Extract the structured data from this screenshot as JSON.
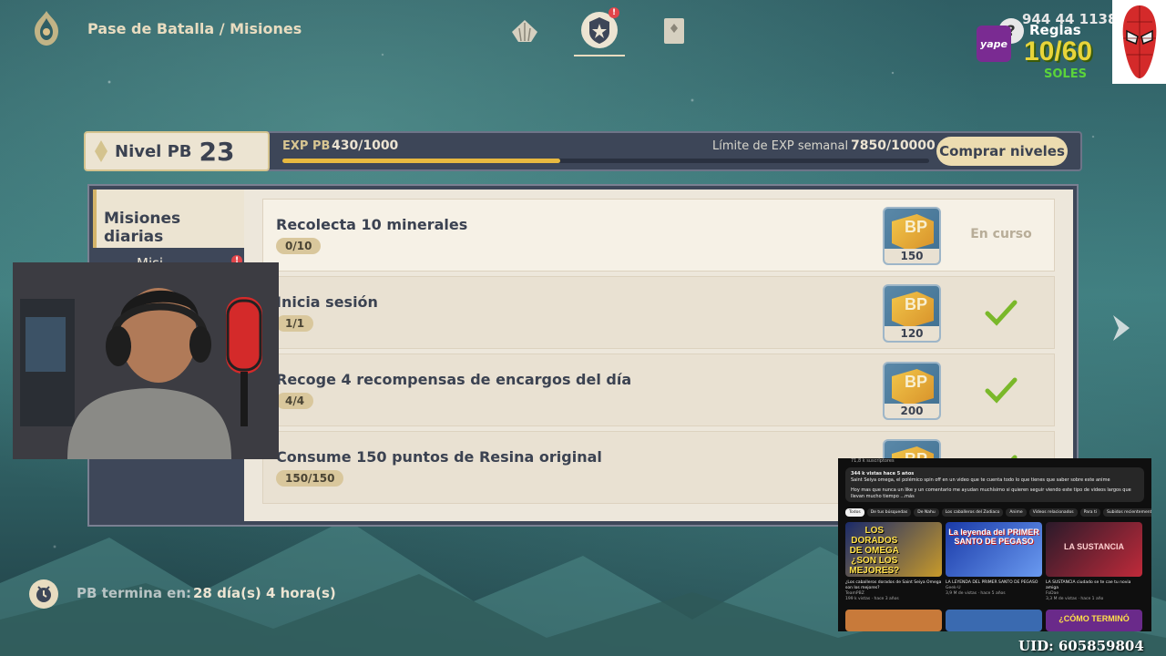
{
  "header": {
    "breadcrumb": "Pase de Batalla / Misiones",
    "tabs": [
      {
        "name": "tab-rewards",
        "icon": "shell-icon"
      },
      {
        "name": "tab-missions",
        "icon": "shield-star-icon",
        "badge": "!",
        "active": true
      },
      {
        "name": "tab-shop",
        "icon": "card-icon"
      }
    ]
  },
  "stream_overlay": {
    "phone": "944 44 1138",
    "reglas": "Reglas",
    "count": "10/60",
    "currency": "SOLES",
    "yape": "yape"
  },
  "level": {
    "label": "Nivel PB",
    "value": "23",
    "exp_label": "EXP PB",
    "exp_value": "430/1000",
    "exp_progress": 0.43,
    "weekly_label": "Límite de EXP semanal",
    "weekly_value": "7850/10000",
    "buy_label": "Comprar niveles"
  },
  "sidebar": {
    "active_tab": "Misiones diarias",
    "second_tab": "Misi",
    "second_badge": "!"
  },
  "missions": [
    {
      "title": "Recolecta 10 minerales",
      "progress": "0/10",
      "reward": "150",
      "status": "En curso",
      "done": false
    },
    {
      "title": "Inicia sesión",
      "progress": "1/1",
      "reward": "120",
      "status": "",
      "done": true
    },
    {
      "title": "Recoge 4 recompensas de encargos del día",
      "progress": "4/4",
      "reward": "200",
      "status": "",
      "done": true
    },
    {
      "title": "Consume 150 puntos de Resina original",
      "progress": "150/150",
      "reward": "",
      "status": "",
      "done": true
    }
  ],
  "reward_icon_text": "BP",
  "footer": {
    "label": "PB termina en:",
    "value": "28 día(s) 4 hora(s)",
    "uid": "UID: 605859804"
  },
  "youtube": {
    "subs": "71,8 k suscriptores",
    "desc_line1": "344 k vistas  hace 5 años",
    "desc_line2": "Saint Seiya omega, el polémico spin off en un video que te cuenta todo lo que tienes que saber sobre este anime",
    "desc_line3": "Hoy mas que nunca un like y un comentario me ayudan muchísimo si quieren seguir viendo este tipo de videos largos que llevan mucho tiempo ...más",
    "chips": [
      "Todos",
      "De tus búsquedas",
      "De Nahu",
      "Los caballeros del Zodiaco",
      "Anime",
      "Videos relacionados",
      "Para ti",
      "Subidos recientemente"
    ],
    "videos": [
      {
        "thumb_text": "LOS DORADOS DE OMEGA ¿SON LOS MEJORES?",
        "title": "¿Los caballeros dorados de Saint Seiya Omega son los mejores?",
        "channel": "TeamPBZ",
        "stats": "199 k vistas · hace 3 años"
      },
      {
        "thumb_text": "La leyenda del PRIMER SANTO DE PEGASO",
        "title": "LA LEYENDA DEL PRIMER SANTO DE PEGASO",
        "channel": "Geek-U",
        "stats": "3,9 M de vistas · hace 5 años"
      },
      {
        "thumb_text": "LA SUSTANCIA",
        "title": "LA SUSTANCIA ciudado se te cae tu novia amiga",
        "channel": "FoDae",
        "stats": "3,3 M de vistas · hace 1 año"
      }
    ],
    "row2_text": "¿CÓMO TERMINÓ"
  }
}
